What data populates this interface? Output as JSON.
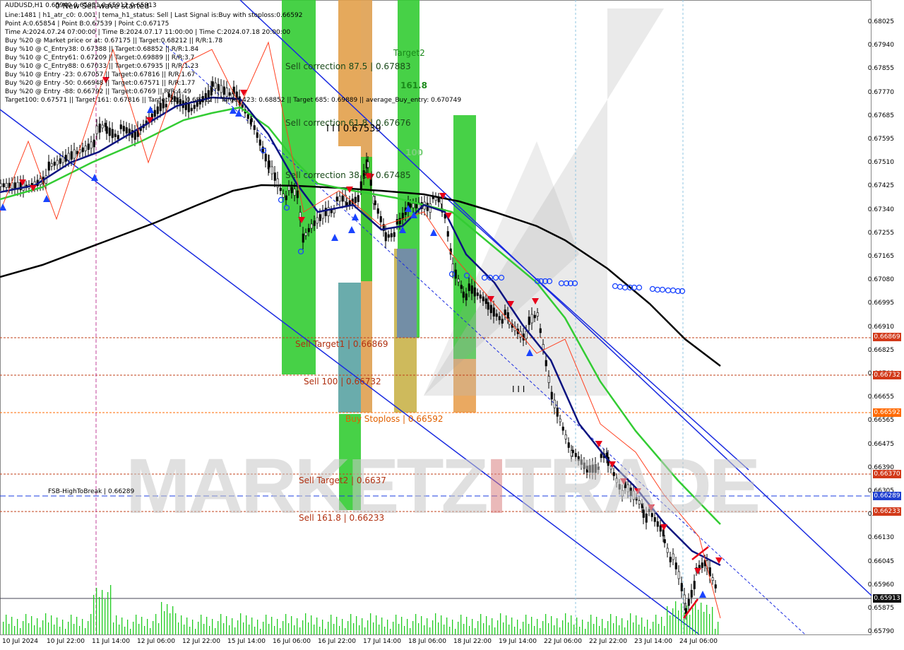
{
  "header": {
    "symbol": "AUDUSD,H1",
    "symbol_values": "0.65940 0.65951 0.65912 0.65913",
    "overlay_text": "0 New Sell wave started",
    "lines": [
      "Line:1481  | h1_atr_c0: 0.001  | tema_h1_status: Sell  | Last Signal is:Buy with stoploss:0.66592",
      "Point A:0.65854 | Point B:0.67539 | Point C:0.67175",
      "Time A:2024.07.24 07:00:00 | Time B:2024.07.17 11:00:00 | Time C:2024.07.18 20:00:00",
      "Buy %20 @ Market price or at: 0.67175  ||  Target:0.68212  ||  R/R:1.78",
      "Buy %10 @ C_Entry38: 0.67388  ||  Target:0.68852  ||  R/R:1.84",
      "Buy %10 @ C_Entry61: 0.67209  ||  Target:0.69889  ||  R/R:3.7",
      "Buy %10 @ C_Entry88: 0.67033  ||  Target:0.67935  ||  R/R:1.23",
      "Buy %10 @ Entry -23: 0.67057  ||  Target:0.67816  ||  R/R:1.67",
      "Buy %20 @ Entry -50: 0.66948  ||  Target:0.67571  ||  R/R:1.77",
      "Buy %20 @ Entry -88: 0.66792  ||  Target:0.6769  ||  R/R:4.49"
    ],
    "targets_line": "Target100: 0.67571  ||  Target 161: 0.67816  ||  Target 261: 0.68212  ||  Target 423: 0.68852  ||  Target 685: 0.69889  ||  average_Buy_entry: 0.670749"
  },
  "labels": {
    "sell_corr_875": "Sell correction 87.5 | 0.67883",
    "sell_corr_618": "Sell correction 61.8 | 0.67676",
    "sell_corr_382": "Sell correction 38.2 | 0.67485",
    "price_ticks_label": "I I I 0.67539",
    "target2": "Target2",
    "t1618": "161.8",
    "t100": "100",
    "sell_target1": "Sell Target1 | 0.66869",
    "sell_100": "Sell 100 | 0.66732",
    "buy_stoploss": "Buy Stoploss | 0.66592",
    "sell_target2": "Sell Target2 | 0.6637",
    "sell_1618": "Sell 161.8 | 0.66233",
    "fsb": "FSB-HighToBreak | 0.66289",
    "iii_mid": "I I I"
  },
  "watermark": {
    "part1": "MARKETZ",
    "part2": "I",
    "part3": "TRADE"
  },
  "price_axis": [
    "0.68025",
    "0.67940",
    "0.67855",
    "0.67770",
    "0.67685",
    "0.67595",
    "0.67510",
    "0.67425",
    "0.67340",
    "0.67255",
    "0.67165",
    "0.67080",
    "0.66995",
    "0.66910",
    "0.66825",
    "0.66740",
    "0.66655",
    "0.66565",
    "0.66475",
    "0.66390",
    "0.66305",
    "0.66220",
    "0.66130",
    "0.66045",
    "0.65960",
    "0.65875",
    "0.65790"
  ],
  "price_tags": [
    {
      "text": "0.66869",
      "color": "#d23a1a"
    },
    {
      "text": "0.66732",
      "color": "#d23a1a"
    },
    {
      "text": "0.66592",
      "color": "#ff6a00"
    },
    {
      "text": "0.66370",
      "color": "#d23a1a"
    },
    {
      "text": "0.66289",
      "color": "#1f3fd0"
    },
    {
      "text": "0.66233",
      "color": "#d23a1a"
    },
    {
      "text": "0.65913",
      "color": "#111111"
    }
  ],
  "time_axis": [
    "10 Jul 2024",
    "10 Jul 22:00",
    "11 Jul 14:00",
    "12 Jul 06:00",
    "12 Jul 22:00",
    "15 Jul 14:00",
    "16 Jul 06:00",
    "16 Jul 22:00",
    "17 Jul 14:00",
    "18 Jul 06:00",
    "18 Jul 22:00",
    "19 Jul 14:00",
    "22 Jul 06:00",
    "22 Jul 22:00",
    "23 Jul 14:00",
    "24 Jul 06:00"
  ],
  "colors": {
    "ema_black": "#000000",
    "tema_navy": "#0b1380",
    "ma_green": "#33cc33",
    "channel_blue": "#1a2be0",
    "sell_red": "#e8001a",
    "buy_blue": "#1a44ff",
    "volume_green": "#22cc22"
  },
  "chart_data": {
    "type": "candlestick",
    "symbol": "AUDUSD",
    "timeframe": "H1",
    "ylim": [
      0.6579,
      0.6807
    ],
    "last_price": 0.65913,
    "x": [
      "10 Jul 2024",
      "10 Jul 22:00",
      "11 Jul 14:00",
      "12 Jul 06:00",
      "12 Jul 22:00",
      "15 Jul 14:00",
      "16 Jul 06:00",
      "16 Jul 22:00",
      "17 Jul 14:00",
      "18 Jul 06:00",
      "18 Jul 22:00",
      "19 Jul 14:00",
      "22 Jul 06:00",
      "22 Jul 22:00",
      "23 Jul 14:00",
      "24 Jul 06:00"
    ],
    "close_approx": [
      0.674,
      0.6745,
      0.677,
      0.6772,
      0.6779,
      0.6775,
      0.673,
      0.6738,
      0.6735,
      0.6738,
      0.6712,
      0.669,
      0.666,
      0.6645,
      0.6625,
      0.66
    ],
    "levels": [
      {
        "name": "Sell Target1",
        "value": 0.66869
      },
      {
        "name": "Sell 100",
        "value": 0.66732
      },
      {
        "name": "Buy Stoploss",
        "value": 0.66592
      },
      {
        "name": "Sell Target2",
        "value": 0.6637
      },
      {
        "name": "FSB-HighToBreak",
        "value": 0.66289
      },
      {
        "name": "Sell 161.8",
        "value": 0.66233
      }
    ]
  }
}
